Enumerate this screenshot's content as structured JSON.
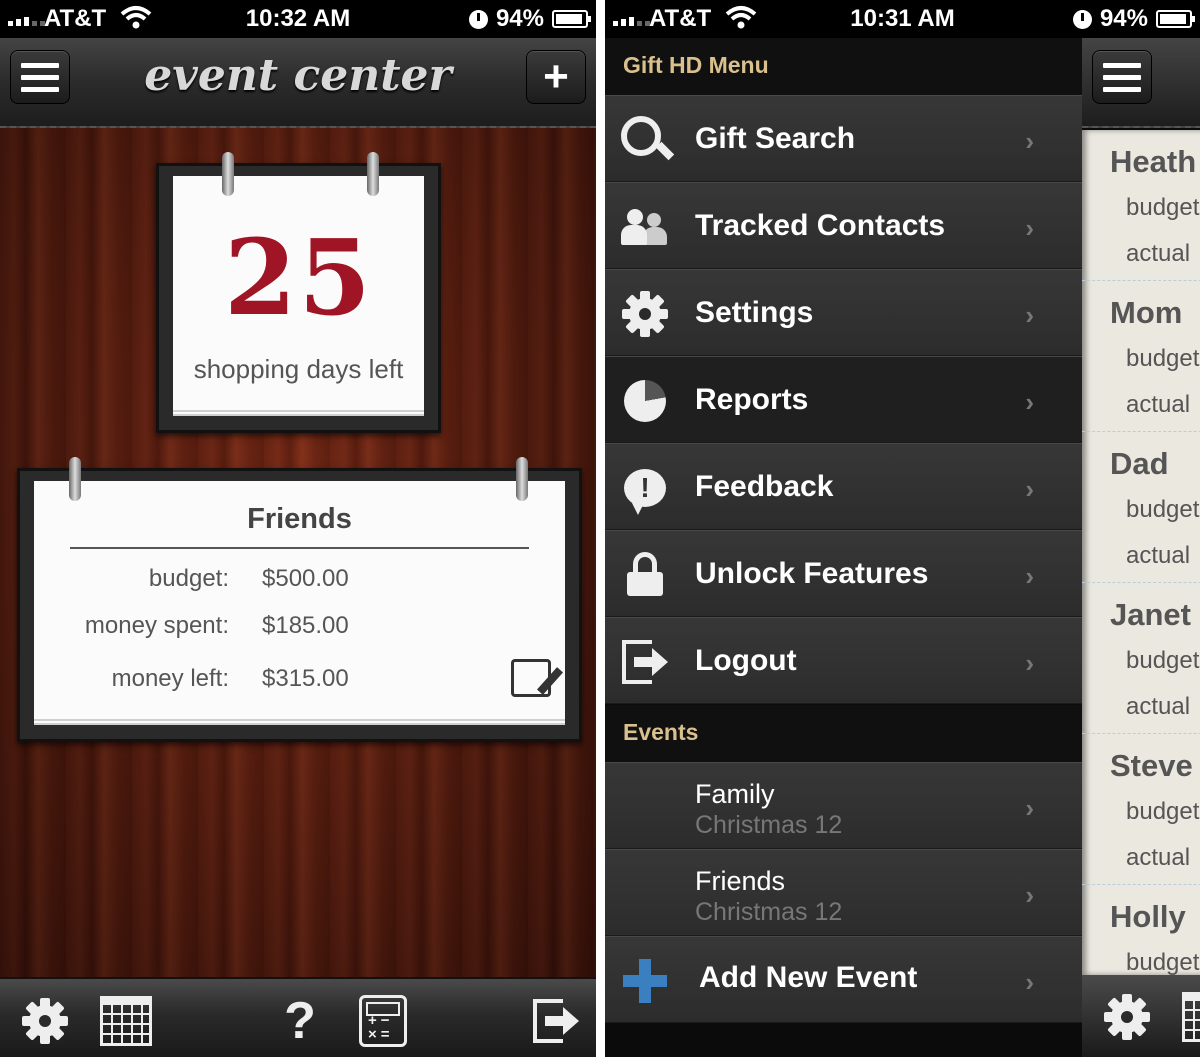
{
  "left_screen": {
    "status": {
      "carrier": "AT&T",
      "time": "10:32 AM",
      "battery": "94%"
    },
    "nav": {
      "title": "event center",
      "menu_icon": "hamburger-icon",
      "add_icon": "plus-icon",
      "add_label": "+"
    },
    "days_card": {
      "number": "25",
      "label": "shopping days left"
    },
    "budget_card": {
      "title": "Friends",
      "rows": [
        {
          "label": "budget:",
          "value": "$500.00"
        },
        {
          "label": "money spent:",
          "value": "$185.00"
        },
        {
          "label": "money left:",
          "value": "$315.00"
        }
      ],
      "edit_icon": "edit-icon"
    },
    "tabbar": {
      "icons": [
        "gear-icon",
        "calendar-icon",
        "help-icon",
        "calculator-icon",
        "logout-icon"
      ],
      "help_label": "?"
    }
  },
  "right_screen": {
    "status": {
      "carrier": "AT&T",
      "time": "10:31 AM",
      "battery": "94%"
    },
    "menu": {
      "header": "Gift HD Menu",
      "items": [
        {
          "label": "Gift Search",
          "icon": "search-icon"
        },
        {
          "label": "Tracked Contacts",
          "icon": "contacts-icon"
        },
        {
          "label": "Settings",
          "icon": "gear-icon"
        },
        {
          "label": "Reports",
          "icon": "pie-chart-icon"
        },
        {
          "label": "Feedback",
          "icon": "feedback-icon"
        },
        {
          "label": "Unlock Features",
          "icon": "lock-icon"
        },
        {
          "label": "Logout",
          "icon": "logout-icon"
        }
      ],
      "chevron": "›",
      "events_header": "Events",
      "events": [
        {
          "title": "Family",
          "subtitle": "Christmas 12"
        },
        {
          "title": "Friends",
          "subtitle": "Christmas 12"
        }
      ],
      "add_event": {
        "label": "Add New Event",
        "icon": "plus-icon"
      }
    },
    "peek_list": {
      "items": [
        {
          "name": "Heath",
          "budget": "budget",
          "actual": "actual"
        },
        {
          "name": "Mom",
          "budget": "budget",
          "actual": "actual"
        },
        {
          "name": "Dad",
          "budget": "budget",
          "actual": "actual"
        },
        {
          "name": "Janet",
          "budget": "budget",
          "actual": "actual"
        },
        {
          "name": "Steve",
          "budget": "budget",
          "actual": "actual"
        },
        {
          "name": "Holly",
          "budget": "budget",
          "actual": "actual"
        }
      ]
    }
  },
  "colors": {
    "accent_red": "#a01525",
    "menu_header": "#d9c08d",
    "add_blue": "#3a7fc0",
    "wood": "#5a1d10"
  }
}
